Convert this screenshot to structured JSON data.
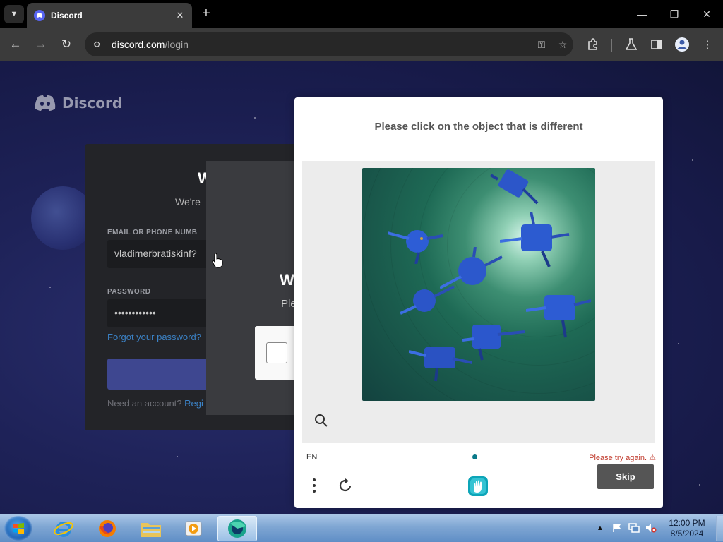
{
  "browser": {
    "tab_title": "Discord",
    "url_host": "discord.com",
    "url_path": "/login"
  },
  "page": {
    "brand": "Discord",
    "login": {
      "heading": "W",
      "subheading": "We're",
      "email_label": "EMAIL OR PHONE NUMB",
      "email_value": "vladimerbratiskinf?",
      "password_label": "PASSWORD",
      "password_value": "••••••••••••",
      "forgot_link": "Forgot your password?",
      "need_account": "Need an account?",
      "register_link": "Regi"
    },
    "verify": {
      "heading": "W",
      "text": "Ple"
    }
  },
  "captcha": {
    "prompt": "Please click on the object that is different",
    "language": "EN",
    "error": "Please try again.",
    "error_icon": "⚠",
    "skip_label": "Skip"
  },
  "taskbar": {
    "time": "12:00 PM",
    "date": "8/5/2024"
  },
  "colors": {
    "discord_blurple": "#5865f2",
    "captcha_skip": "#555555",
    "captcha_error": "#c0392b"
  }
}
